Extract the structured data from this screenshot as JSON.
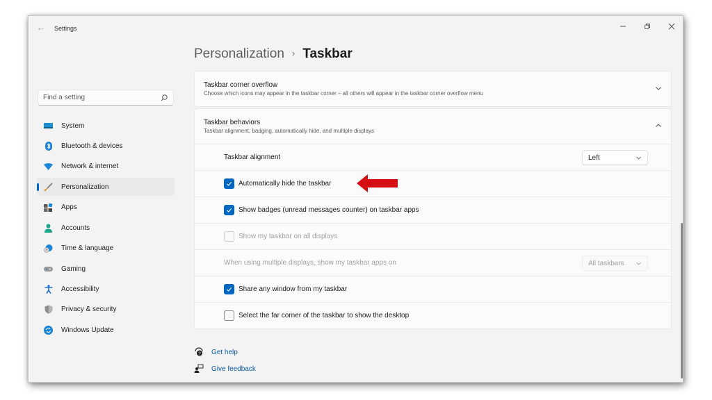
{
  "window": {
    "title": "Settings",
    "controls": {
      "minimize": "minimize",
      "maximize": "restore",
      "close": "close"
    }
  },
  "search": {
    "placeholder": "Find a setting",
    "value": ""
  },
  "sidebar": {
    "selected": "Personalization",
    "items": [
      {
        "label": "System",
        "icon": "monitor-icon"
      },
      {
        "label": "Bluetooth & devices",
        "icon": "bluetooth-icon"
      },
      {
        "label": "Network & internet",
        "icon": "wifi-icon"
      },
      {
        "label": "Personalization",
        "icon": "paintbrush-icon"
      },
      {
        "label": "Apps",
        "icon": "apps-icon"
      },
      {
        "label": "Accounts",
        "icon": "person-icon"
      },
      {
        "label": "Time & language",
        "icon": "globe-clock-icon"
      },
      {
        "label": "Gaming",
        "icon": "gamepad-icon"
      },
      {
        "label": "Accessibility",
        "icon": "accessibility-icon"
      },
      {
        "label": "Privacy & security",
        "icon": "shield-icon"
      },
      {
        "label": "Windows Update",
        "icon": "refresh-icon"
      }
    ]
  },
  "breadcrumb": {
    "parent": "Personalization",
    "separator": "›",
    "current": "Taskbar"
  },
  "sections": {
    "corner_overflow": {
      "title": "Taskbar corner overflow",
      "subtitle": "Choose which icons may appear in the taskbar corner – all others will appear in the taskbar corner overflow menu",
      "expanded": false
    },
    "behaviors": {
      "title": "Taskbar behaviors",
      "subtitle": "Taskbar alignment, badging, automatically hide, and multiple displays",
      "expanded": true,
      "alignment": {
        "label": "Taskbar alignment",
        "value": "Left"
      },
      "auto_hide": {
        "label": "Automatically hide the taskbar",
        "checked": true
      },
      "badges": {
        "label": "Show badges (unread messages counter) on taskbar apps",
        "checked": true
      },
      "all_displays": {
        "label": "Show my taskbar on all displays",
        "checked": false,
        "disabled": true
      },
      "multi_display": {
        "label": "When using multiple displays, show my taskbar apps on",
        "value": "All taskbars",
        "disabled": true
      },
      "share_window": {
        "label": "Share any window from my taskbar",
        "checked": true
      },
      "far_corner": {
        "label": "Select the far corner of the taskbar to show the desktop",
        "checked": false
      }
    }
  },
  "footer_links": {
    "help": "Get help",
    "feedback": "Give feedback"
  },
  "annotation": {
    "type": "red-arrow",
    "points_to": "Automatically hide the taskbar",
    "color": "#d40f14"
  },
  "colors": {
    "accent": "#0067c0",
    "link": "#0b5cad",
    "window_bg": "#f3f3f3",
    "card_bg": "#fbfbfb"
  }
}
